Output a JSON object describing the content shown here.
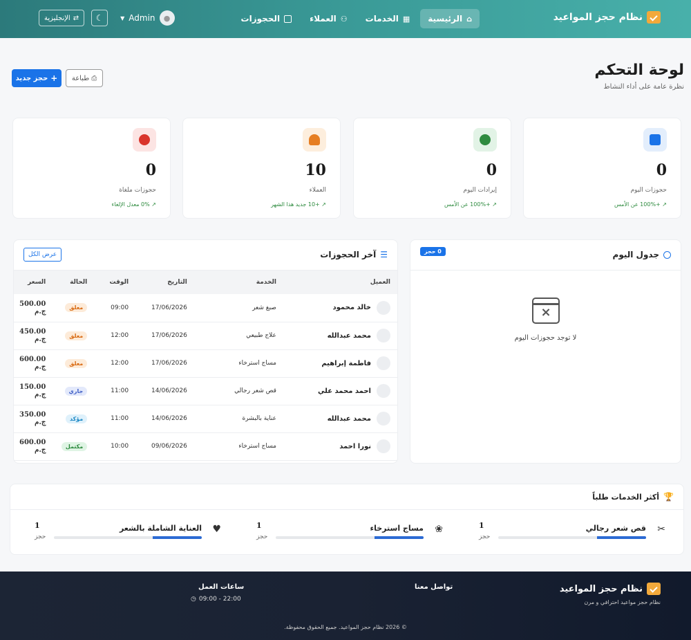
{
  "brand": {
    "name": "نظام حجز المواعيد"
  },
  "nav": {
    "links": [
      {
        "label": "الرئيسية"
      },
      {
        "label": "الخدمات"
      },
      {
        "label": "العملاء"
      },
      {
        "label": "الحجوزات"
      }
    ],
    "user": "Admin",
    "lang_label": "الإنجليزية"
  },
  "header": {
    "title": "لوحة التحكم",
    "subtitle": "نظرة عامة على أداء النشاط",
    "new_booking": "حجز جديد",
    "print": "طباعة"
  },
  "stats": [
    {
      "value": "0",
      "label": "حجوزات اليوم",
      "trend": "+100% عن الأمس",
      "color": "#1a73e8"
    },
    {
      "value": "0",
      "label": "إيرادات اليوم",
      "trend": "+100% عن الأمس",
      "color": "#2e8b3f"
    },
    {
      "value": "10",
      "label": "العملاء",
      "trend": "+10 جديد هذا الشهر",
      "color": "#e67e22"
    },
    {
      "value": "0",
      "label": "حجوزات ملغاة",
      "trend": "0% معدل الإلغاء",
      "color": "#d9342b"
    }
  ],
  "today": {
    "title": "جدول اليوم",
    "badge": "0 حجز",
    "empty": "لا توجد حجوزات اليوم"
  },
  "bookings": {
    "title": "آخر الحجوزات",
    "view_all": "عرض الكل",
    "columns": [
      "العميل",
      "الخدمة",
      "التاريخ",
      "الوقت",
      "الحالة",
      "السعر"
    ],
    "rows": [
      {
        "customer": "خالد محمود",
        "service": "صبغ شعر",
        "date": "17/06/2026",
        "time": "09:00",
        "status": "معلق",
        "status_type": "pending",
        "price": "500.00 ج.م"
      },
      {
        "customer": "محمد عبدالله",
        "service": "علاج طبيعي",
        "date": "17/06/2026",
        "time": "12:00",
        "status": "معلق",
        "status_type": "pending",
        "price": "450.00 ج.م"
      },
      {
        "customer": "فاطمة إبراهيم",
        "service": "مساج استرخاء",
        "date": "17/06/2026",
        "time": "12:00",
        "status": "معلق",
        "status_type": "pending",
        "price": "600.00 ج.م"
      },
      {
        "customer": "احمد محمد علي",
        "service": "قص شعر رجالي",
        "date": "14/06/2026",
        "time": "11:00",
        "status": "جاري",
        "status_type": "progress",
        "price": "150.00 ج.م"
      },
      {
        "customer": "محمد عبدالله",
        "service": "عناية بالبشرة",
        "date": "14/06/2026",
        "time": "11:00",
        "status": "مؤكد",
        "status_type": "confirmed",
        "price": "350.00 ج.م"
      },
      {
        "customer": "نورا احمد",
        "service": "مساج استرخاء",
        "date": "09/06/2026",
        "time": "10:00",
        "status": "مكتمل",
        "status_type": "done",
        "price": "600.00 ج.م"
      }
    ]
  },
  "top_services": {
    "title": "أكثر الخدمات طلباً",
    "items": [
      {
        "name": "قص شعر رجالي",
        "count": "1",
        "unit": "حجز",
        "share": 0.33,
        "icon": "scissors-icon"
      },
      {
        "name": "مساج استرخاء",
        "count": "1",
        "unit": "حجز",
        "share": 0.33,
        "icon": "spa-icon"
      },
      {
        "name": "العناية الشاملة بالشعر",
        "count": "1",
        "unit": "حجز",
        "share": 0.33,
        "icon": "heart-icon"
      }
    ]
  },
  "footer": {
    "brand": "نظام حجز المواعيد",
    "desc": "نظام حجز مواعيد احترافي و مرن",
    "contact": "تواصل معنا",
    "hours_title": "ساعات العمل",
    "hours": "09:00 - 22:00",
    "copyright": "© 2026 نظام حجز المواعيد. جميع الحقوق محفوظة."
  }
}
